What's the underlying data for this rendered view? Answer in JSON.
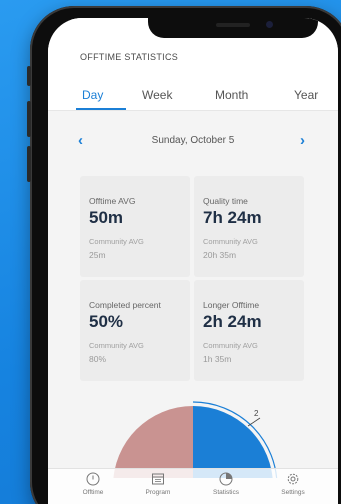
{
  "header": {
    "title": "OFFTIME STATISTICS"
  },
  "tabs": [
    {
      "label": "Day",
      "active": true
    },
    {
      "label": "Week",
      "active": false
    },
    {
      "label": "Month",
      "active": false
    },
    {
      "label": "Year",
      "active": false
    }
  ],
  "date_nav": {
    "prev_icon": "chevron-left-icon",
    "date": "Sunday, October 5",
    "next_icon": "chevron-right-icon"
  },
  "stats": [
    {
      "label": "Offtime AVG",
      "value": "50m",
      "community_label": "Community AVG",
      "community_value": "25m"
    },
    {
      "label": "Quality time",
      "value": "7h 24m",
      "community_label": "Community AVG",
      "community_value": "20h 35m"
    },
    {
      "label": "Completed percent",
      "value": "50%",
      "community_label": "Community AVG",
      "community_value": "80%"
    },
    {
      "label": "Longer Offtime",
      "value": "2h 24m",
      "community_label": "Community AVG",
      "community_value": "1h 35m"
    }
  ],
  "chart": {
    "segment_label": "2",
    "colors": {
      "left": "#c99391",
      "right": "#1b7fd6"
    }
  },
  "bottom_nav": [
    {
      "label": "Offtime",
      "icon": "clock-icon"
    },
    {
      "label": "Program",
      "icon": "calendar-icon"
    },
    {
      "label": "Statistics",
      "icon": "pie-chart-icon"
    },
    {
      "label": "Settings",
      "icon": "gear-icon"
    }
  ],
  "colors": {
    "accent": "#1b7fd6",
    "background": "#1e8de6",
    "value_text": "#1f2f45"
  }
}
